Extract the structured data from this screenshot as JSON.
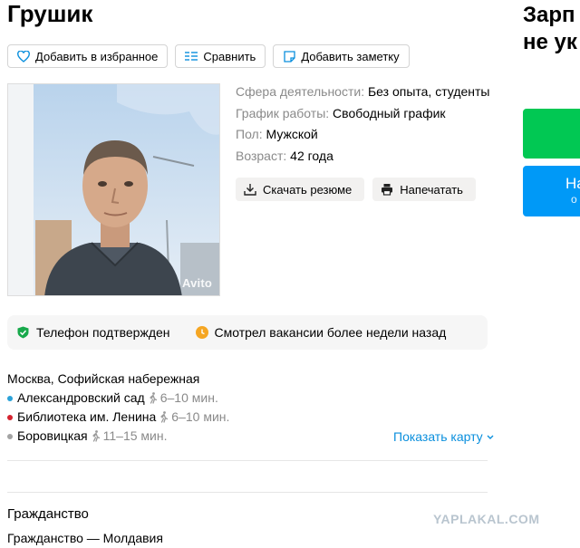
{
  "profile": {
    "name": "Грушик"
  },
  "sidebar": {
    "title_line1": "Зарп",
    "title_line2": "не ук",
    "blue_button_line1": "На",
    "blue_button_line2": "о",
    "green_color": "#01c853",
    "blue_color": "#0099f7"
  },
  "actions": {
    "favorite_label": "Добавить в избранное",
    "compare_label": "Сравнить",
    "note_label": "Добавить заметку"
  },
  "photo": {
    "watermark": "Avito"
  },
  "details": {
    "sphere_label": "Сфера деятельности:",
    "sphere_value": "Без опыта, студенты",
    "schedule_label": "График работы:",
    "schedule_value": "Свободный график",
    "gender_label": "Пол:",
    "gender_value": "Мужской",
    "age_label": "Возраст:",
    "age_value": "42 года"
  },
  "resume_actions": {
    "download_label": "Скачать резюме",
    "print_label": "Напечатать"
  },
  "status": {
    "phone_verified": "Телефон подтвержден",
    "last_seen": "Смотрел вакансии более недели назад"
  },
  "location": {
    "address": "Москва, Софийская набережная",
    "metro": [
      {
        "name": "Александровский сад",
        "time": "6–10 мин.",
        "color": "#2ba2d8"
      },
      {
        "name": "Библиотека им. Ленина",
        "time": "6–10 мин.",
        "color": "#d5232f"
      },
      {
        "name": "Боровицкая",
        "time": "11–15 мин.",
        "color": "#a3a3a3"
      }
    ],
    "show_map": "Показать карту"
  },
  "citizenship": {
    "heading": "Гражданство",
    "value": "Гражданство — Молдавия"
  },
  "watermark": {
    "site": "YAPLAKAL.COM"
  },
  "colors": {
    "accent_link": "#0a8fdd",
    "shield_green": "#17a94b",
    "clock_orange": "#f5a623"
  }
}
